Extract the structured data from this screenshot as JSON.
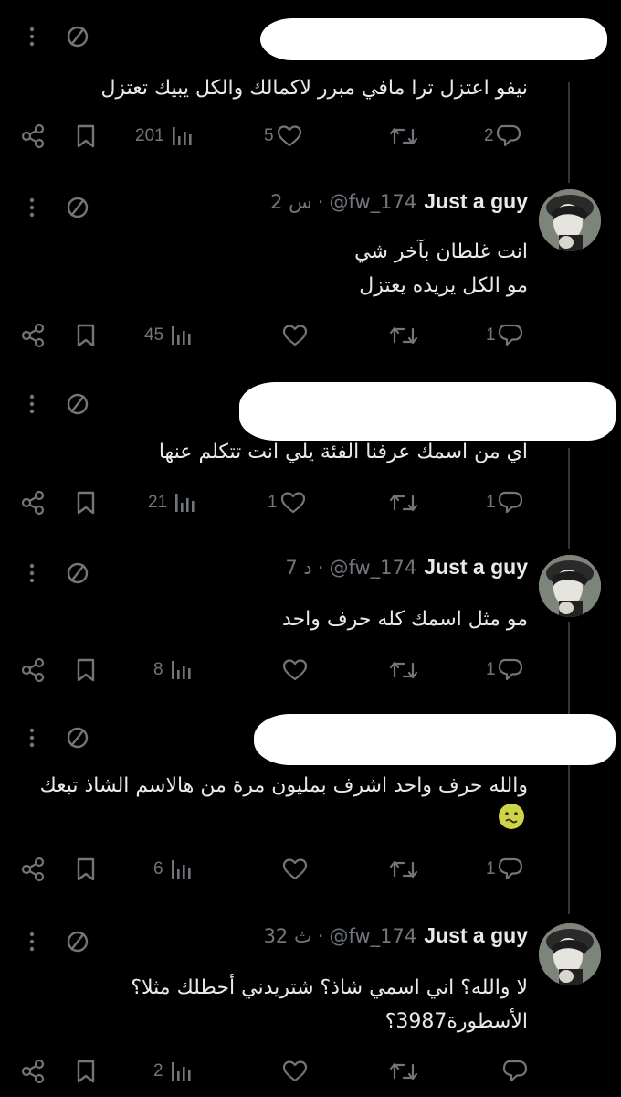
{
  "tweets": [
    {
      "id": "t1",
      "redacted_author": true,
      "text": "نيفو اعتزل ترا مافي مبرر لاكمالك والكل يبيك تعتزل",
      "replies": "2",
      "likes": "5",
      "views": "201",
      "retweets": ""
    },
    {
      "id": "t2",
      "name": "Just a guy",
      "handle": "@fw_174",
      "dot": "·",
      "time": "2 س",
      "text": "انت غلطان بآخر شي\nمو الكل يريده يعتزل",
      "replies": "1",
      "likes": "",
      "views": "45",
      "retweets": ""
    },
    {
      "id": "t3",
      "redacted_author": true,
      "text": "اي من اسمك عرفنا الفئة يلي انت تتكلم عنها",
      "replies": "1",
      "likes": "1",
      "views": "21",
      "retweets": ""
    },
    {
      "id": "t4",
      "name": "Just a guy",
      "handle": "@fw_174",
      "dot": "·",
      "time": "7 د",
      "text": "مو مثل اسمك كله حرف واحد",
      "replies": "1",
      "likes": "",
      "views": "8",
      "retweets": ""
    },
    {
      "id": "t5",
      "redacted_author": true,
      "text": "والله حرف واحد اشرف بمليون مرة من هالاسم الشاذ تبعك",
      "emoji": "nauseated-face-emoji",
      "replies": "1",
      "likes": "",
      "views": "6",
      "retweets": ""
    },
    {
      "id": "t6",
      "name": "Just a guy",
      "handle": "@fw_174",
      "dot": "·",
      "time": "32 ث",
      "text": "لا والله؟ اني اسمي شاذ؟ شتريدني أحطلك مثلا؟\nالأسطورة3987؟",
      "replies": "",
      "likes": "",
      "views": "2",
      "retweets": ""
    }
  ],
  "icons": {
    "more": "more-vertical-icon",
    "not_allowed": "no-entry-circle-icon",
    "share": "share-icon",
    "bookmark": "bookmark-icon",
    "views": "analytics-bars-icon",
    "like": "heart-icon",
    "retweet": "retweet-icon",
    "reply": "reply-bubble-icon"
  },
  "colors": {
    "background": "#000000",
    "text": "#e7e9ea",
    "muted": "#71767b",
    "thread_line": "#333639"
  }
}
